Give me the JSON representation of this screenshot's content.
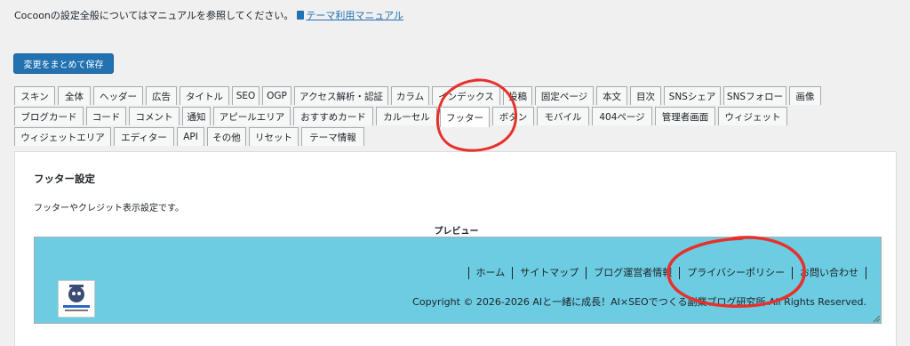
{
  "intro": {
    "text": "Cocoonの設定全般についてはマニュアルを参照してください。",
    "link_label": "テーマ利用マニュアル",
    "link_icon": "book-icon"
  },
  "save_button": {
    "label": "変更をまとめて保存"
  },
  "tabs": {
    "active": "フッター",
    "rows": [
      [
        "スキン",
        "全体",
        "ヘッダー",
        "広告",
        "タイトル",
        "SEO",
        "OGP",
        "アクセス解析・認証",
        "カラム",
        "インデックス",
        "投稿",
        "固定ページ",
        "本文",
        "目次",
        "SNSシェア",
        "SNSフォロー",
        "画像"
      ],
      [
        "ブログカード",
        "コード",
        "コメント",
        "通知",
        "アピールエリア",
        "おすすめカード",
        "カルーセル",
        "フッター",
        "ボタン",
        "モバイル",
        "404ページ",
        "管理者画面",
        "ウィジェット"
      ],
      [
        "ウィジェットエリア",
        "エディター",
        "API",
        "その他",
        "リセット",
        "テーマ情報"
      ]
    ]
  },
  "panel": {
    "title": "フッター設定",
    "description": "フッターやクレジット表示設定です。",
    "preview_label": "プレビュー",
    "footer_menu": [
      "ホーム",
      "サイトマップ",
      "ブログ運営者情報",
      "プライバシーポリシー",
      "お問い合わせ"
    ],
    "copyright": "Copyright © 2026-2026 AIと一緒に成長！AI×SEOでつくる副業ブログ研究所 All Rights Reserved.",
    "logo_text": "AIと一緒に成長！",
    "preview_bg": "#6ccce1"
  },
  "colors": {
    "accent": "#2271b1",
    "annotation": "#e8302a"
  }
}
